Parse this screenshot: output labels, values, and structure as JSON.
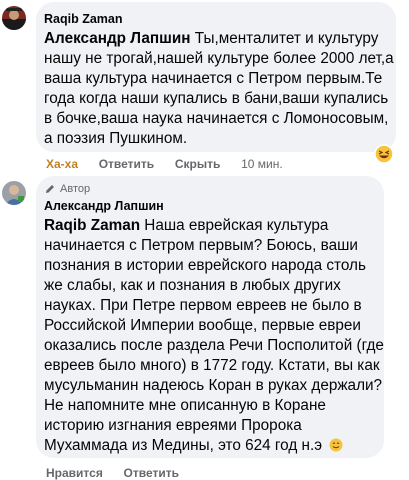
{
  "comment1": {
    "author": "Raqib Zaman",
    "mention": "Александр Лапшин",
    "lines": [
      " Ты,менталитет и культуру",
      "нашу не трогай,нашей культуре более 2000 лет,а",
      "ваша культура начинается с Петром первым.Те",
      "года когда наши купались в бани,ваши купались",
      "в бочке,ваша наука начинается с Ломоносовым,",
      "а поэзия Пушкином."
    ],
    "reaction_label": "Ха-ха",
    "reply_label": "Ответить",
    "hide_label": "Скрыть",
    "time": "10 мин.",
    "reaction_icon": "laughing-emoji-icon"
  },
  "comment2": {
    "badge": "Автор",
    "badge_icon": "pencil-icon",
    "author": "Александр Лапшин",
    "mention": "Raqib Zaman",
    "lines": [
      " Наша еврейская культура",
      "начинается с Петром первым? Боюсь, ваши",
      "познания в истории еврейского народа столь",
      "же слабы, как и познания в любых других",
      "науках. При Петре первом евреев не было в",
      "Российской Империи вообще, первые евреи",
      "оказались после раздела Речи Посполитой (где",
      "евреев было много) в 1772 году. Кстати, вы как",
      "мусульманин надеюсь Коран в руках держали?",
      "Не напомните мне описанную в Коране",
      "историю изгнания евреями Пророка",
      "Мухаммада из Медины, это 624 год н.э"
    ],
    "end_emoji_icon": "smiling-emoji-icon",
    "reply_label": "Нравится",
    "reply2_label": "Ответить"
  }
}
